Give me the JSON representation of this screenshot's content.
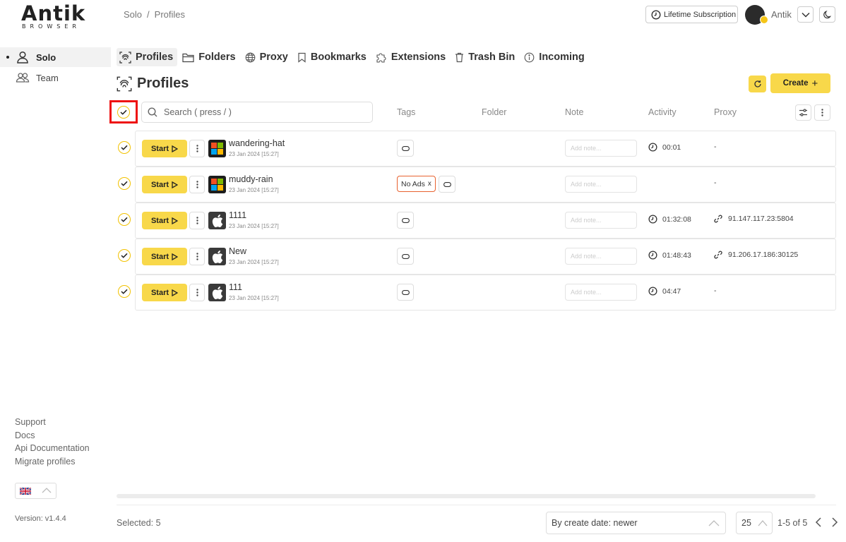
{
  "logo": {
    "main": "Antik",
    "sub": "BROWSER"
  },
  "sidebar": {
    "items": [
      {
        "label": "Solo",
        "icon": "user-icon",
        "active": true
      },
      {
        "label": "Team",
        "icon": "team-icon",
        "active": false
      }
    ],
    "links": [
      "Support",
      "Docs",
      "Api Documentation",
      "Migrate profiles"
    ],
    "language_flag": "uk-flag-icon",
    "version": "Version: v1.4.4"
  },
  "header": {
    "breadcrumb": [
      "Solo",
      "/",
      "Profiles"
    ],
    "subscription": "Lifetime Subscription",
    "username": "Antik"
  },
  "tabs": [
    {
      "label": "Profiles",
      "icon": "fingerprint-icon",
      "active": true
    },
    {
      "label": "Folders",
      "icon": "folder-icon",
      "active": false
    },
    {
      "label": "Proxy",
      "icon": "globe-icon",
      "active": false
    },
    {
      "label": "Bookmarks",
      "icon": "bookmark-icon",
      "active": false
    },
    {
      "label": "Extensions",
      "icon": "puzzle-icon",
      "active": false
    },
    {
      "label": "Trash Bin",
      "icon": "trash-icon",
      "active": false
    },
    {
      "label": "Incoming",
      "icon": "info-icon",
      "active": false
    }
  ],
  "page": {
    "title": "Profiles",
    "create_label": "Create",
    "create_plus": "+"
  },
  "table": {
    "search_placeholder": "Search ( press / )",
    "columns": {
      "tags": "Tags",
      "folder": "Folder",
      "note": "Note",
      "activity": "Activity",
      "proxy": "Proxy"
    },
    "start_label": "Start",
    "note_placeholder": "Add note...",
    "rows": [
      {
        "name": "wandering-hat",
        "date": "23 Jan 2024 [15:27]",
        "os": "windows",
        "tag": "",
        "activity": "00:01",
        "proxy": "-"
      },
      {
        "name": "muddy-rain",
        "date": "23 Jan 2024 [15:27]",
        "os": "windows",
        "tag": "No Ads",
        "tag_close": "x",
        "activity": "",
        "proxy": "-"
      },
      {
        "name": "1111",
        "date": "23 Jan 2024 [15:27]",
        "os": "apple",
        "tag": "",
        "activity": "01:32:08",
        "proxy": "91.147.117.23:5804"
      },
      {
        "name": "New",
        "date": "23 Jan 2024 [15:27]",
        "os": "apple",
        "tag": "",
        "activity": "01:48:43",
        "proxy": "91.206.17.186:30125"
      },
      {
        "name": "111",
        "date": "23 Jan 2024 [15:27]",
        "os": "apple",
        "tag": "",
        "activity": "04:47",
        "proxy": "-"
      }
    ]
  },
  "footer": {
    "selected": "Selected: 5",
    "sort": "By create date: newer",
    "per_page": "25",
    "range": "1-5 of 5"
  },
  "colors": {
    "accent": "#f8d84a",
    "highlight": "#e11111",
    "tag_border": "#e8622f"
  }
}
